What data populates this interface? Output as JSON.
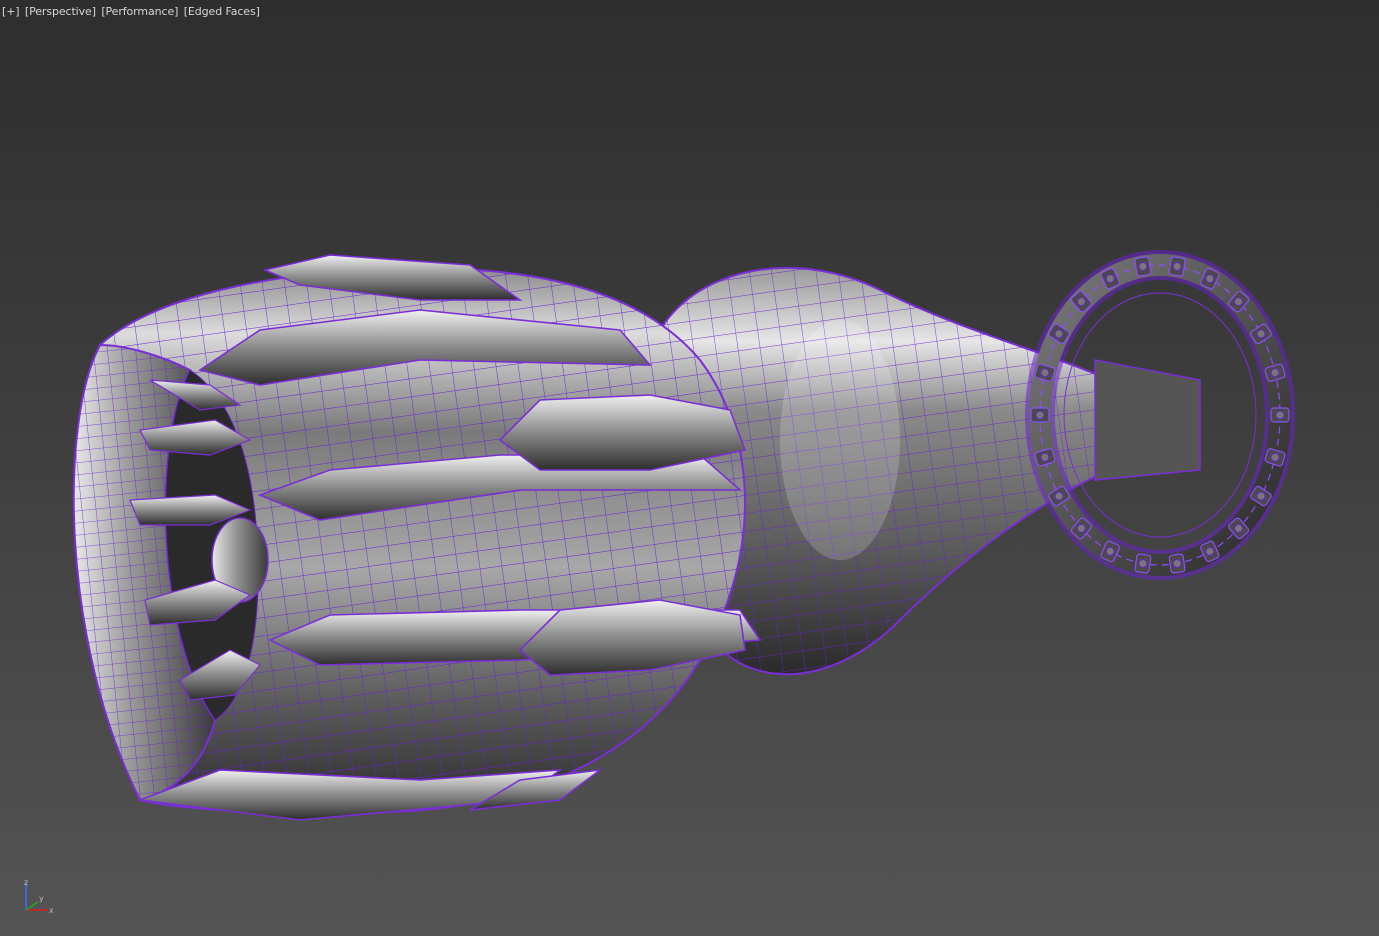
{
  "viewport": {
    "menu_plus": "[+]",
    "view_mode": "[Perspective]",
    "performance": "[Performance]",
    "shading": "[Edged Faces]",
    "axis": {
      "x": "x",
      "y": "y",
      "z": "z"
    }
  },
  "colors": {
    "background_top": "#2e2e2e",
    "background_bottom": "#545454",
    "wire": "#7a2fd6",
    "mesh_highlight": "#eeeeee",
    "mesh_shadow": "#1a1a1a"
  }
}
